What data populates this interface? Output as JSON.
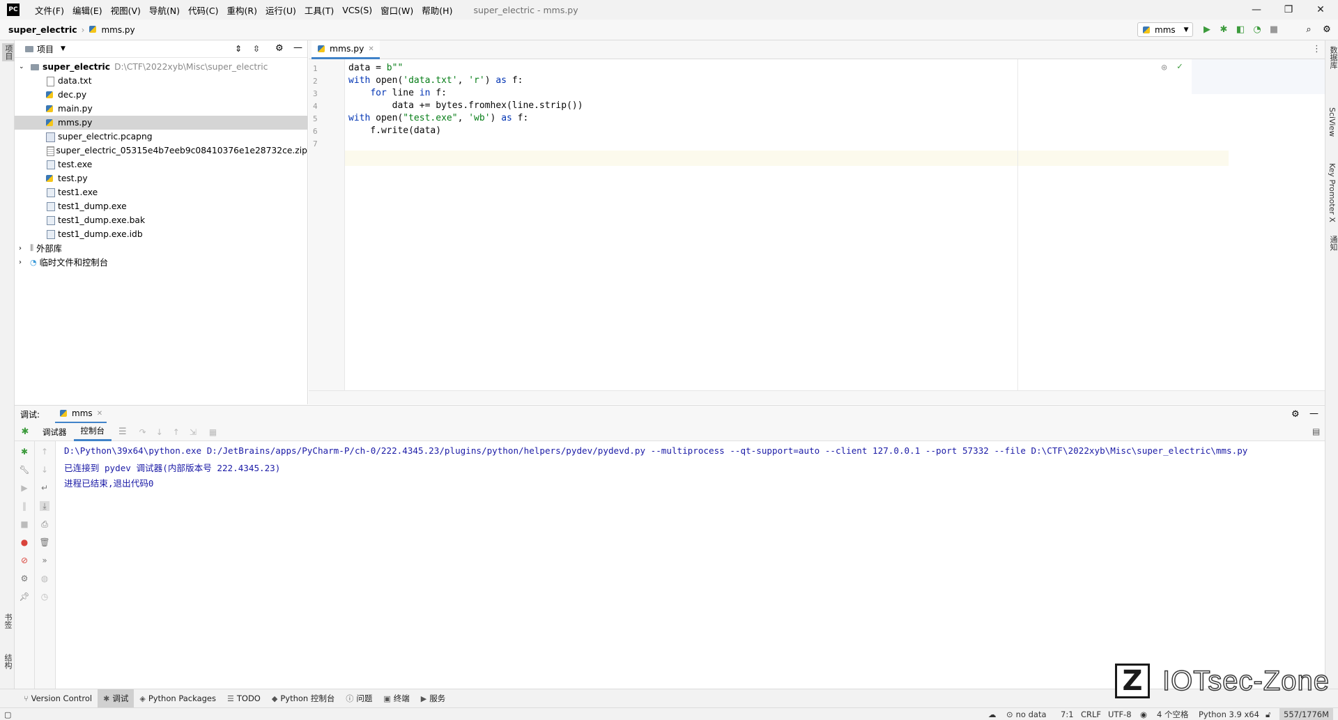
{
  "app": {
    "logo": "PC",
    "window_title": "super_electric - mms.py",
    "menu": [
      "文件(F)",
      "编辑(E)",
      "视图(V)",
      "导航(N)",
      "代码(C)",
      "重构(R)",
      "运行(U)",
      "工具(T)",
      "VCS(S)",
      "窗口(W)",
      "帮助(H)"
    ],
    "window_controls": {
      "minimize": "—",
      "restore": "❐",
      "close": "✕"
    }
  },
  "navbar": {
    "project": "super_electric",
    "file": "mms.py",
    "run_config": "mms"
  },
  "left_stripe": {
    "project_label": "项目",
    "bookmarks_label": "书签",
    "structure_label": "结构"
  },
  "right_stripe": {
    "database_label": "数据库",
    "sciview_label": "SciView",
    "key_promoter_label": "Key Promoter X",
    "notifications_label": "通知"
  },
  "project_panel": {
    "title": "项目",
    "root": {
      "name": "super_electric",
      "path": "D:\\CTF\\2022xyb\\Misc\\super_electric"
    },
    "files": [
      {
        "name": "data.txt",
        "icon": "txt-icon"
      },
      {
        "name": "dec.py",
        "icon": "py-icon"
      },
      {
        "name": "main.py",
        "icon": "py-icon"
      },
      {
        "name": "mms.py",
        "icon": "py-icon",
        "selected": true
      },
      {
        "name": "super_electric.pcapng",
        "icon": "pcap-icon"
      },
      {
        "name": "super_electric_05315e4b7eeb9c08410376e1e28732ce.zip",
        "icon": "zip-icon"
      },
      {
        "name": "test.exe",
        "icon": "exe-icon"
      },
      {
        "name": "test.py",
        "icon": "py-icon"
      },
      {
        "name": "test1.exe",
        "icon": "exe-icon"
      },
      {
        "name": "test1_dump.exe",
        "icon": "exe-icon"
      },
      {
        "name": "test1_dump.exe.bak",
        "icon": "exe-icon"
      },
      {
        "name": "test1_dump.exe.idb",
        "icon": "exe-icon"
      }
    ],
    "external_libs": "外部库",
    "scratches": "临时文件和控制台"
  },
  "editor": {
    "tab": "mms.py",
    "lines": [
      {
        "n": "1",
        "text": "data = b\"\""
      },
      {
        "n": "2",
        "text": "with open('data.txt', 'r') as f:"
      },
      {
        "n": "3",
        "text": "    for line in f:"
      },
      {
        "n": "4",
        "text": "        data += bytes.fromhex(line.strip())"
      },
      {
        "n": "5",
        "text": "with open(\"test.exe\", 'wb') as f:"
      },
      {
        "n": "6",
        "text": "    f.write(data)"
      },
      {
        "n": "7",
        "text": ""
      }
    ]
  },
  "debug": {
    "label": "调试:",
    "session_tab": "mms",
    "tabs": [
      "调试器",
      "控制台"
    ],
    "console": [
      "D:\\Python\\39x64\\python.exe D:/JetBrains/apps/PyCharm-P/ch-0/222.4345.23/plugins/python/helpers/pydev/pydevd.py --multiprocess --qt-support=auto --client 127.0.0.1 --port 57332 --file D:\\CTF\\2022xyb\\Misc\\super_electric\\mms.py",
      "已连接到 pydev 调试器(内部版本号 222.4345.23)",
      "进程已结束,退出代码0"
    ]
  },
  "toolbar_bottom": [
    {
      "label": "Version Control",
      "icon": "branch-icon"
    },
    {
      "label": "调试",
      "icon": "bug-icon",
      "active": true
    },
    {
      "label": "Python Packages",
      "icon": "packages-icon"
    },
    {
      "label": "TODO",
      "icon": "list-icon"
    },
    {
      "label": "Python 控制台",
      "icon": "python-console-icon"
    },
    {
      "label": "问题",
      "icon": "info-icon"
    },
    {
      "label": "终端",
      "icon": "terminal-icon"
    },
    {
      "label": "服务",
      "icon": "services-icon"
    }
  ],
  "status": {
    "no_data": "no data",
    "position": "7:1",
    "line_sep": "CRLF",
    "encoding": "UTF-8",
    "indent": "4 个空格",
    "interpreter": "Python 3.9 x64",
    "memory": "557/1776M"
  },
  "watermark": {
    "logo": "Z",
    "text": "IOTsec-Zone"
  },
  "colors": {
    "accent": "#4083c9",
    "keyword": "#0033b3",
    "string": "#067d17",
    "console_text": "#1a1aa6"
  }
}
